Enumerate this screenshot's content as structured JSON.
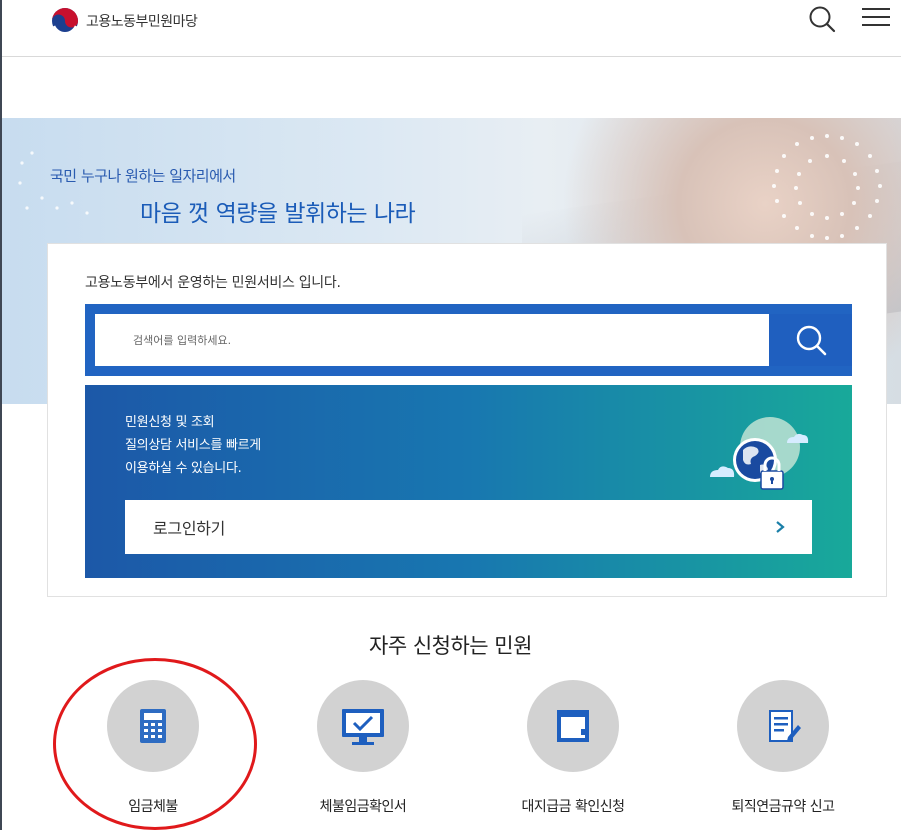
{
  "header": {
    "logo_text": "고용노동부민원마당",
    "search_icon": "search-icon",
    "menu_icon": "hamburger-menu-icon"
  },
  "hero": {
    "subtitle": "국민 누구나 원하는 일자리에서",
    "title": "마음 껏 역량을 발휘하는 나라"
  },
  "card": {
    "intro": "고용노동부에서 운영하는 민원서비스 입니다.",
    "search": {
      "placeholder": "검색어를 입력하세요.",
      "value": ""
    },
    "login_panel": {
      "lines": [
        "민원신청 및 조회",
        "질의상담 서비스를 빠르게",
        "이용하실 수 있습니다."
      ],
      "button_label": "로그인하기"
    }
  },
  "frequent": {
    "title": "자주 신청하는 민원",
    "items": [
      {
        "label": "임금체불",
        "icon": "calculator-icon"
      },
      {
        "label": "체불임금확인서",
        "icon": "monitor-check-icon"
      },
      {
        "label": "대지급금 확인신청",
        "icon": "document-icon"
      },
      {
        "label": "퇴직연금규약 신고",
        "icon": "document-pen-icon"
      }
    ]
  },
  "colors": {
    "primary_blue": "#2164c2",
    "highlight_red": "#e0191b",
    "gradient_teal": "#18a99a"
  }
}
